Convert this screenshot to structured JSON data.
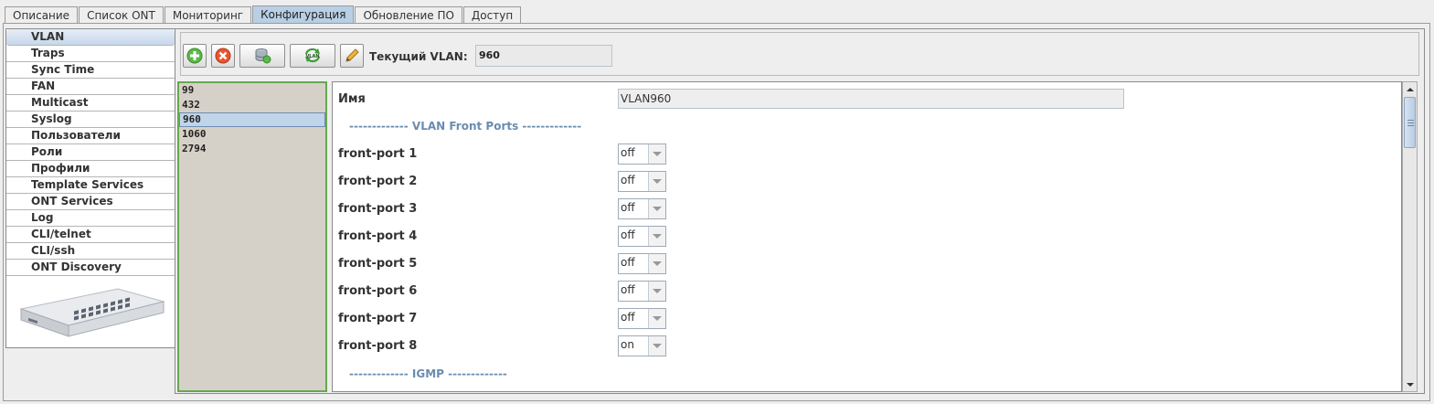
{
  "tabs": [
    {
      "label": "Описание"
    },
    {
      "label": "Список ONT"
    },
    {
      "label": "Мониторинг"
    },
    {
      "label": "Конфигурация",
      "active": true
    },
    {
      "label": "Обновление ПО"
    },
    {
      "label": "Доступ"
    }
  ],
  "sidebar": {
    "items": [
      {
        "label": "VLAN",
        "selected": true
      },
      {
        "label": "Traps"
      },
      {
        "label": "Sync Time"
      },
      {
        "label": "FAN"
      },
      {
        "label": "Multicast"
      },
      {
        "label": "Syslog"
      },
      {
        "label": "Пользователи"
      },
      {
        "label": "Роли"
      },
      {
        "label": "Профили"
      },
      {
        "label": "Template Services"
      },
      {
        "label": "ONT Services"
      },
      {
        "label": "Log"
      },
      {
        "label": "CLI/telnet"
      },
      {
        "label": "CLI/ssh"
      },
      {
        "label": "ONT Discovery"
      }
    ],
    "device_image": "olt-device-image"
  },
  "toolbar": {
    "buttons": [
      {
        "icon": "add-icon"
      },
      {
        "icon": "delete-icon"
      },
      {
        "icon": "database-icon"
      },
      {
        "icon": "refresh-vlan-icon"
      },
      {
        "icon": "pencil-icon"
      }
    ],
    "current_vlan_label": "Текущий VLAN:",
    "current_vlan_value": "960"
  },
  "vlan_list": {
    "items": [
      "99",
      "432",
      "960",
      "1060",
      "2794"
    ],
    "selected": "960"
  },
  "properties": {
    "name_label": "Имя",
    "name_value": "VLAN960",
    "front_ports_header": "------------- VLAN Front Ports -------------",
    "front_ports": [
      {
        "label": "front-port 1",
        "value": "off"
      },
      {
        "label": "front-port 2",
        "value": "off"
      },
      {
        "label": "front-port 3",
        "value": "off"
      },
      {
        "label": "front-port 4",
        "value": "off"
      },
      {
        "label": "front-port 5",
        "value": "off"
      },
      {
        "label": "front-port 6",
        "value": "off"
      },
      {
        "label": "front-port 7",
        "value": "off"
      },
      {
        "label": "front-port 8",
        "value": "on"
      }
    ],
    "igmp_header": "------------- IGMP -------------"
  },
  "colors": {
    "active_tab": "#b8cfe5",
    "list_border": "#66a84f",
    "list_background": "#d6d1c8",
    "section_header": "#6a8cb0"
  }
}
